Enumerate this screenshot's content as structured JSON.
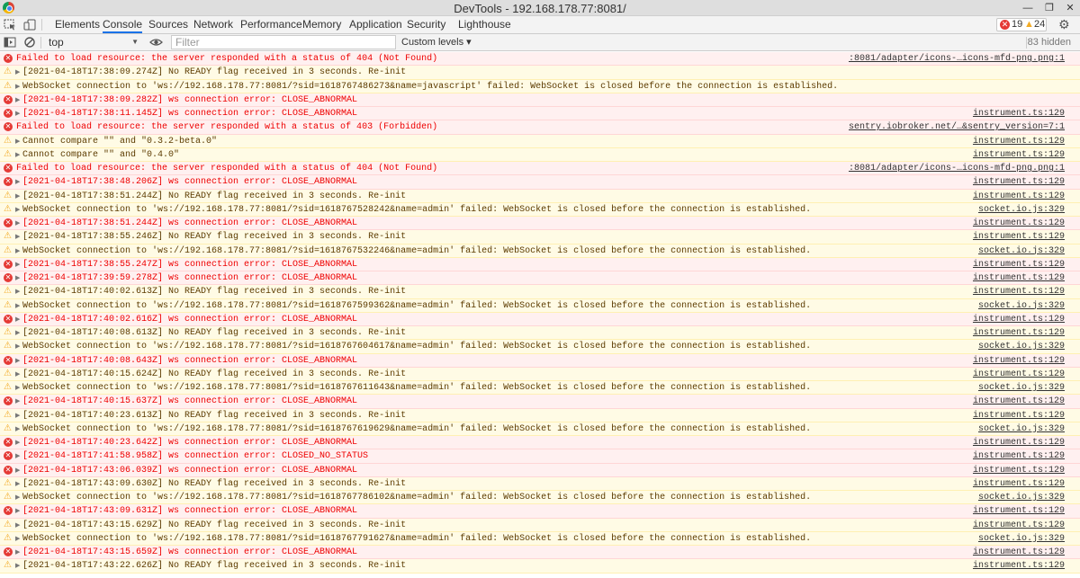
{
  "window": {
    "title": "DevTools - 192.168.178.77:8081/"
  },
  "tabs": [
    "Elements",
    "Console",
    "Sources",
    "Network",
    "Performance",
    "Memory",
    "Application",
    "Security",
    "Lighthouse"
  ],
  "active_tab": "Console",
  "counts": {
    "errors": "19",
    "warnings": "24"
  },
  "toolbar": {
    "context": "top",
    "filter_placeholder": "Filter",
    "levels": "Custom levels ▾",
    "hidden": "83 hidden"
  },
  "messages": [
    {
      "level": "error",
      "expandable": false,
      "text": "Failed to load resource: the server responded with a status of 404 (Not Found)",
      "source": ":8081/adapter/icons-…icons-mfd-png.png:1"
    },
    {
      "level": "warning",
      "expandable": true,
      "text": "[2021-04-18T17:38:09.274Z] No READY flag received in 3 seconds. Re-init",
      "source": ""
    },
    {
      "level": "warning",
      "expandable": true,
      "text": "WebSocket connection to 'ws://192.168.178.77:8081/?sid=1618767486273&name=javascript' failed: WebSocket is closed before the connection is established.",
      "source": ""
    },
    {
      "level": "error",
      "expandable": true,
      "text": "[2021-04-18T17:38:09.282Z] ws connection error: CLOSE_ABNORMAL",
      "source": ""
    },
    {
      "level": "error",
      "expandable": true,
      "text": "[2021-04-18T17:38:11.145Z] ws connection error: CLOSE_ABNORMAL",
      "source": "instrument.ts:129"
    },
    {
      "level": "error",
      "expandable": false,
      "text": "Failed to load resource: the server responded with a status of 403 (Forbidden)",
      "source": "sentry.iobroker.net/…&sentry_version=7:1"
    },
    {
      "level": "warning",
      "expandable": true,
      "text": "Cannot compare \"\" and \"0.3.2-beta.0\"",
      "source": "instrument.ts:129"
    },
    {
      "level": "warning",
      "expandable": true,
      "text": "Cannot compare \"\" and \"0.4.0\"",
      "source": "instrument.ts:129"
    },
    {
      "level": "error",
      "expandable": false,
      "text": "Failed to load resource: the server responded with a status of 404 (Not Found)",
      "source": ":8081/adapter/icons-…icons-mfd-png.png:1"
    },
    {
      "level": "error",
      "expandable": true,
      "text": "[2021-04-18T17:38:48.206Z] ws connection error: CLOSE_ABNORMAL",
      "source": "instrument.ts:129"
    },
    {
      "level": "warning",
      "expandable": true,
      "text": "[2021-04-18T17:38:51.244Z] No READY flag received in 3 seconds. Re-init",
      "source": "instrument.ts:129"
    },
    {
      "level": "warning",
      "expandable": true,
      "text": "WebSocket connection to 'ws://192.168.178.77:8081/?sid=1618767528242&name=admin' failed: WebSocket is closed before the connection is established.",
      "source": "socket.io.js:329"
    },
    {
      "level": "error",
      "expandable": true,
      "text": "[2021-04-18T17:38:51.244Z] ws connection error: CLOSE_ABNORMAL",
      "source": "instrument.ts:129"
    },
    {
      "level": "warning",
      "expandable": true,
      "text": "[2021-04-18T17:38:55.246Z] No READY flag received in 3 seconds. Re-init",
      "source": "instrument.ts:129"
    },
    {
      "level": "warning",
      "expandable": true,
      "text": "WebSocket connection to 'ws://192.168.178.77:8081/?sid=1618767532246&name=admin' failed: WebSocket is closed before the connection is established.",
      "source": "socket.io.js:329"
    },
    {
      "level": "error",
      "expandable": true,
      "text": "[2021-04-18T17:38:55.247Z] ws connection error: CLOSE_ABNORMAL",
      "source": "instrument.ts:129"
    },
    {
      "level": "error",
      "expandable": true,
      "text": "[2021-04-18T17:39:59.278Z] ws connection error: CLOSE_ABNORMAL",
      "source": "instrument.ts:129"
    },
    {
      "level": "warning",
      "expandable": true,
      "text": "[2021-04-18T17:40:02.613Z] No READY flag received in 3 seconds. Re-init",
      "source": "instrument.ts:129"
    },
    {
      "level": "warning",
      "expandable": true,
      "text": "WebSocket connection to 'ws://192.168.178.77:8081/?sid=1618767599362&name=admin' failed: WebSocket is closed before the connection is established.",
      "source": "socket.io.js:329"
    },
    {
      "level": "error",
      "expandable": true,
      "text": "[2021-04-18T17:40:02.616Z] ws connection error: CLOSE_ABNORMAL",
      "source": "instrument.ts:129"
    },
    {
      "level": "warning",
      "expandable": true,
      "text": "[2021-04-18T17:40:08.613Z] No READY flag received in 3 seconds. Re-init",
      "source": "instrument.ts:129"
    },
    {
      "level": "warning",
      "expandable": true,
      "text": "WebSocket connection to 'ws://192.168.178.77:8081/?sid=1618767604617&name=admin' failed: WebSocket is closed before the connection is established.",
      "source": "socket.io.js:329"
    },
    {
      "level": "error",
      "expandable": true,
      "text": "[2021-04-18T17:40:08.643Z] ws connection error: CLOSE_ABNORMAL",
      "source": "instrument.ts:129"
    },
    {
      "level": "warning",
      "expandable": true,
      "text": "[2021-04-18T17:40:15.624Z] No READY flag received in 3 seconds. Re-init",
      "source": "instrument.ts:129"
    },
    {
      "level": "warning",
      "expandable": true,
      "text": "WebSocket connection to 'ws://192.168.178.77:8081/?sid=1618767611643&name=admin' failed: WebSocket is closed before the connection is established.",
      "source": "socket.io.js:329"
    },
    {
      "level": "error",
      "expandable": true,
      "text": "[2021-04-18T17:40:15.637Z] ws connection error: CLOSE_ABNORMAL",
      "source": "instrument.ts:129"
    },
    {
      "level": "warning",
      "expandable": true,
      "text": "[2021-04-18T17:40:23.613Z] No READY flag received in 3 seconds. Re-init",
      "source": "instrument.ts:129"
    },
    {
      "level": "warning",
      "expandable": true,
      "text": "WebSocket connection to 'ws://192.168.178.77:8081/?sid=1618767619629&name=admin' failed: WebSocket is closed before the connection is established.",
      "source": "socket.io.js:329"
    },
    {
      "level": "error",
      "expandable": true,
      "text": "[2021-04-18T17:40:23.642Z] ws connection error: CLOSE_ABNORMAL",
      "source": "instrument.ts:129"
    },
    {
      "level": "error",
      "expandable": true,
      "text": "[2021-04-18T17:41:58.958Z] ws connection error: CLOSED_NO_STATUS",
      "source": "instrument.ts:129"
    },
    {
      "level": "error",
      "expandable": true,
      "text": "[2021-04-18T17:43:06.039Z] ws connection error: CLOSE_ABNORMAL",
      "source": "instrument.ts:129"
    },
    {
      "level": "warning",
      "expandable": true,
      "text": "[2021-04-18T17:43:09.630Z] No READY flag received in 3 seconds. Re-init",
      "source": "instrument.ts:129"
    },
    {
      "level": "warning",
      "expandable": true,
      "text": "WebSocket connection to 'ws://192.168.178.77:8081/?sid=1618767786102&name=admin' failed: WebSocket is closed before the connection is established.",
      "source": "socket.io.js:329"
    },
    {
      "level": "error",
      "expandable": true,
      "text": "[2021-04-18T17:43:09.631Z] ws connection error: CLOSE_ABNORMAL",
      "source": "instrument.ts:129"
    },
    {
      "level": "warning",
      "expandable": true,
      "text": "[2021-04-18T17:43:15.629Z] No READY flag received in 3 seconds. Re-init",
      "source": "instrument.ts:129"
    },
    {
      "level": "warning",
      "expandable": true,
      "text": "WebSocket connection to 'ws://192.168.178.77:8081/?sid=1618767791627&name=admin' failed: WebSocket is closed before the connection is established.",
      "source": "socket.io.js:329"
    },
    {
      "level": "error",
      "expandable": true,
      "text": "[2021-04-18T17:43:15.659Z] ws connection error: CLOSE_ABNORMAL",
      "source": "instrument.ts:129"
    },
    {
      "level": "warning",
      "expandable": true,
      "text": "[2021-04-18T17:43:22.626Z] No READY flag received in 3 seconds. Re-init",
      "source": "instrument.ts:129"
    }
  ],
  "colors": {
    "error_bg": "#fff0f0",
    "error_text": "#e00000",
    "warning_bg": "#fffbe5",
    "accent": "#1a73e8"
  },
  "icons": {
    "error": "error-icon",
    "warning": "warning-icon",
    "settings": "gear-icon"
  }
}
